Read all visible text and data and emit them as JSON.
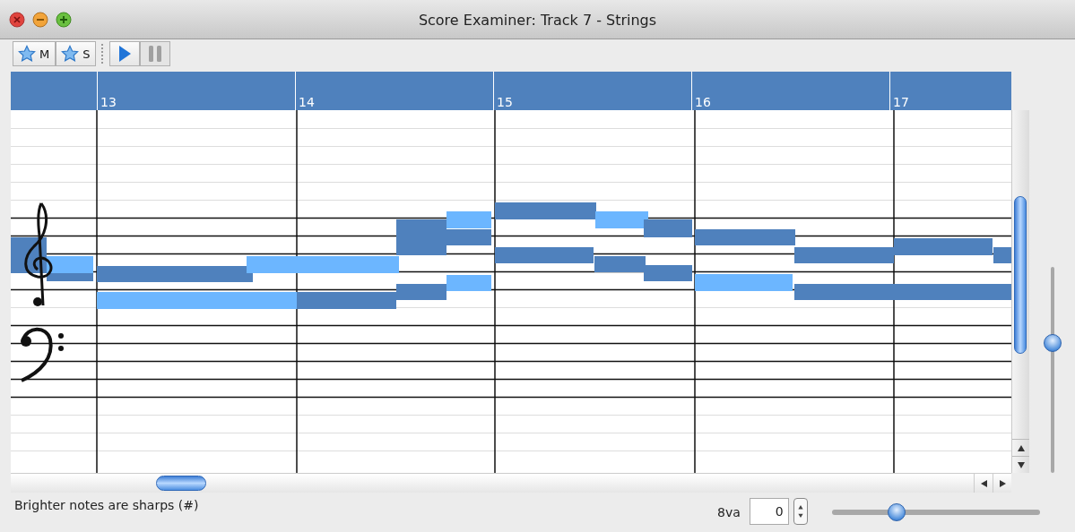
{
  "window": {
    "title": "Score Examiner: Track 7 - Strings"
  },
  "toolbar": {
    "toggles": [
      {
        "label": "M",
        "kind": "star"
      },
      {
        "label": "S",
        "kind": "star"
      }
    ],
    "transport": [
      {
        "kind": "play",
        "disabled": false
      },
      {
        "kind": "pause",
        "disabled": true
      }
    ]
  },
  "measures": [
    "13",
    "14",
    "15",
    "16",
    "17"
  ],
  "vertical_zoom": {
    "level": 0.63
  },
  "status_bar": {
    "hint": "Brighter notes are sharps (#)",
    "octave_label": "8va",
    "octave_value": "0",
    "zoom": {
      "level": 0.31
    }
  }
}
